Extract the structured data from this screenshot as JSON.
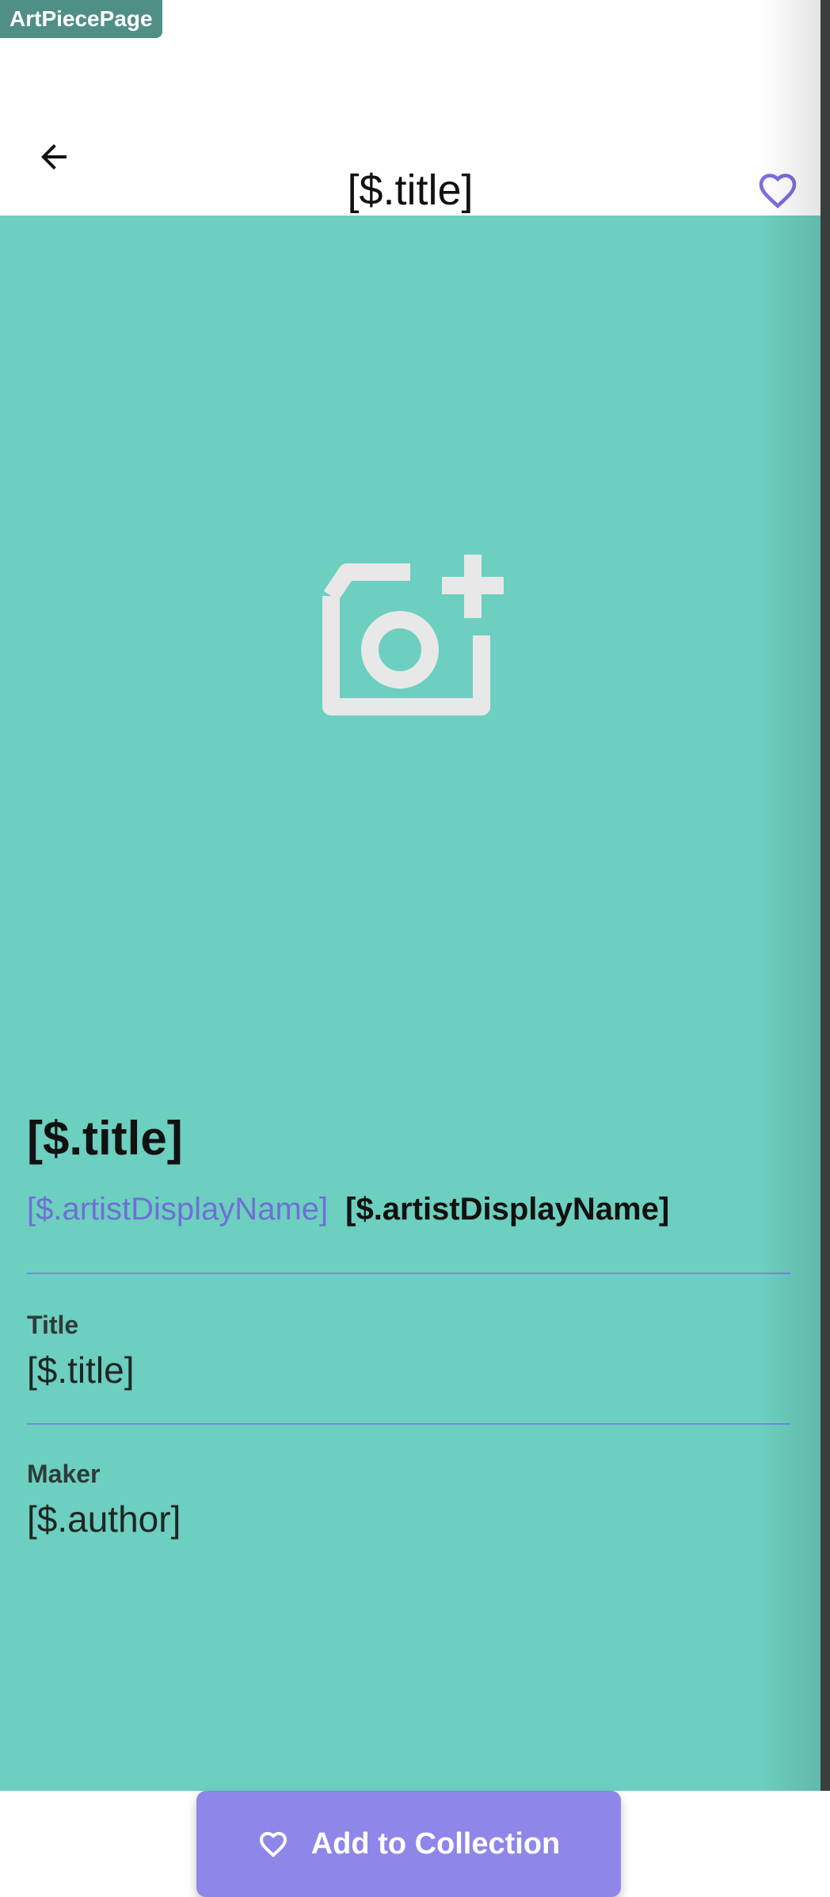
{
  "page_tag": "ArtPiecePage",
  "app_bar": {
    "title": "[$.title]",
    "back_icon": "arrow-left-icon",
    "favorite_icon": "heart-outline-icon"
  },
  "hero": {
    "placeholder_icon": "add-a-photo-icon"
  },
  "details": {
    "title": "[$.title]",
    "artist_link": "[$.artistDisplayName]",
    "artist_name": "[$.artistDisplayName]",
    "fields": [
      {
        "label": "Title",
        "value": "[$.title]"
      },
      {
        "label": "Maker",
        "value": "[$.author]"
      }
    ]
  },
  "actions": {
    "add_to_collection": "Add to Collection",
    "add_icon": "heart-outline-icon"
  },
  "colors": {
    "accent": "#7b6ee0",
    "background": "#6ccfbf",
    "button": "#8f86ea"
  }
}
